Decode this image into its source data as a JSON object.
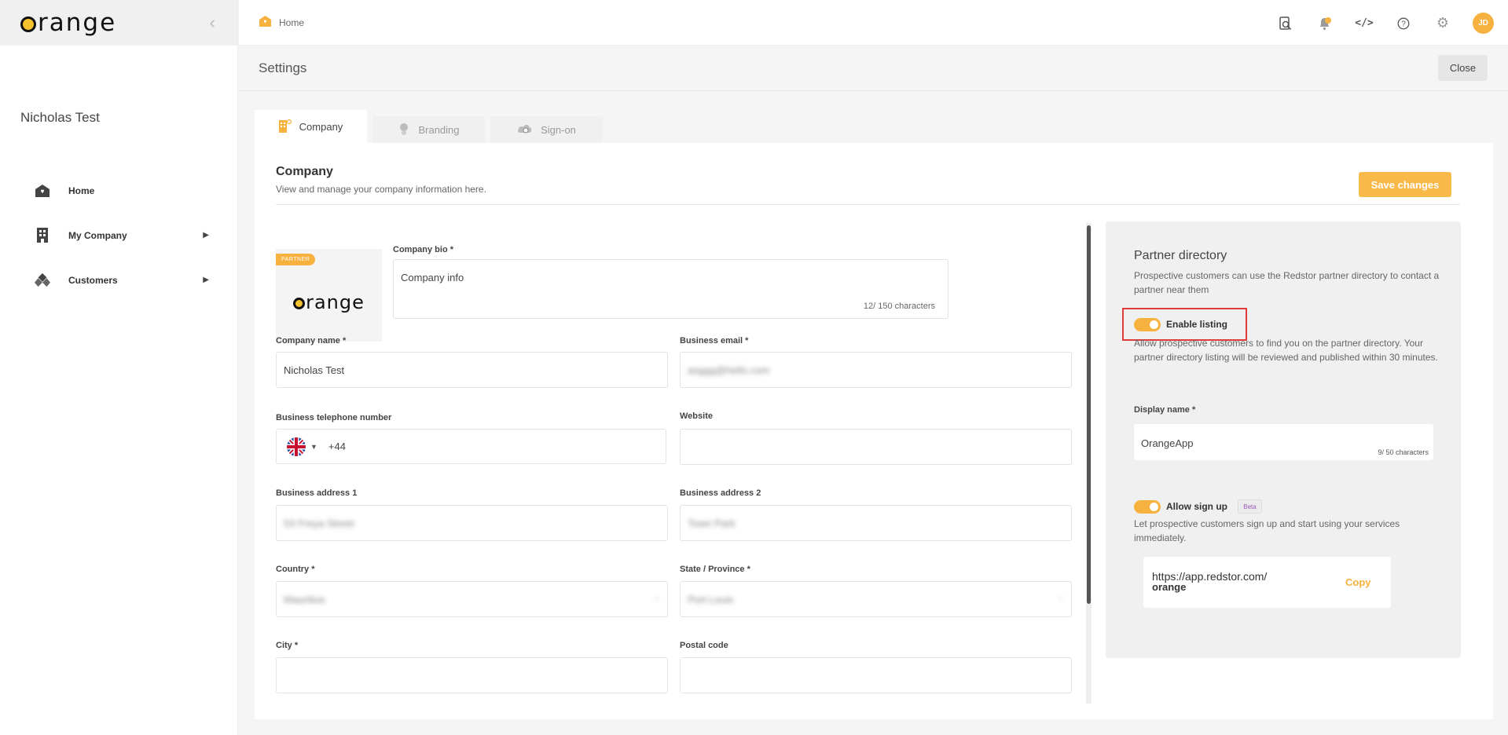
{
  "app": {
    "logo_text": "range"
  },
  "sidebar": {
    "user_name": "Nicholas Test",
    "items": [
      {
        "label": "Home",
        "icon": "home-icon"
      },
      {
        "label": "My Company",
        "icon": "building-icon"
      },
      {
        "label": "Customers",
        "icon": "customers-icon"
      }
    ]
  },
  "topbar": {
    "breadcrumb": "Home",
    "avatar_initials": "JD"
  },
  "settings": {
    "title": "Settings",
    "close_label": "Close"
  },
  "tabs": [
    {
      "label": "Company",
      "active": true
    },
    {
      "label": "Branding",
      "active": false
    },
    {
      "label": "Sign-on",
      "active": false
    }
  ],
  "company": {
    "title": "Company",
    "subtitle": "View and manage your company information here.",
    "save_label": "Save changes",
    "partner_badge": "PARTNER",
    "logo_text": "range",
    "bio_label": "Company bio *",
    "bio_value": "Company info",
    "bio_count": "12/ 150 characters",
    "name_label": "Company name *",
    "name_value": "Nicholas Test",
    "email_label": "Business email *",
    "email_value": "asggg@hello.com",
    "phone_label": "Business telephone number",
    "phone_code": "+44",
    "website_label": "Website",
    "website_value": "",
    "addr1_label": "Business address 1",
    "addr1_value": "53 Freya Street",
    "addr2_label": "Business address 2",
    "addr2_value": "Town Park",
    "country_label": "Country *",
    "country_value": "Mauritius",
    "state_label": "State / Province *",
    "state_value": "Port Louis",
    "city_label": "City *",
    "postal_label": "Postal code"
  },
  "partner": {
    "title": "Partner directory",
    "subtitle": "Prospective customers can use the Redstor partner directory to contact a partner near them",
    "enable_label": "Enable listing",
    "enable_desc": "Allow prospective customers to find you on the partner directory. Your partner directory listing will be reviewed and published within 30 minutes.",
    "display_label": "Display name *",
    "display_value": "OrangeApp",
    "display_count": "9/ 50 characters",
    "signup_label": "Allow sign up",
    "beta": "Beta",
    "signup_desc": "Let prospective customers sign up and start using your services immediately.",
    "url_prefix": "https://app.redstor.com/",
    "url_slug": "orange",
    "copy_label": "Copy"
  },
  "colors": {
    "accent": "#f7b13f",
    "highlight": "#e23b3b"
  }
}
